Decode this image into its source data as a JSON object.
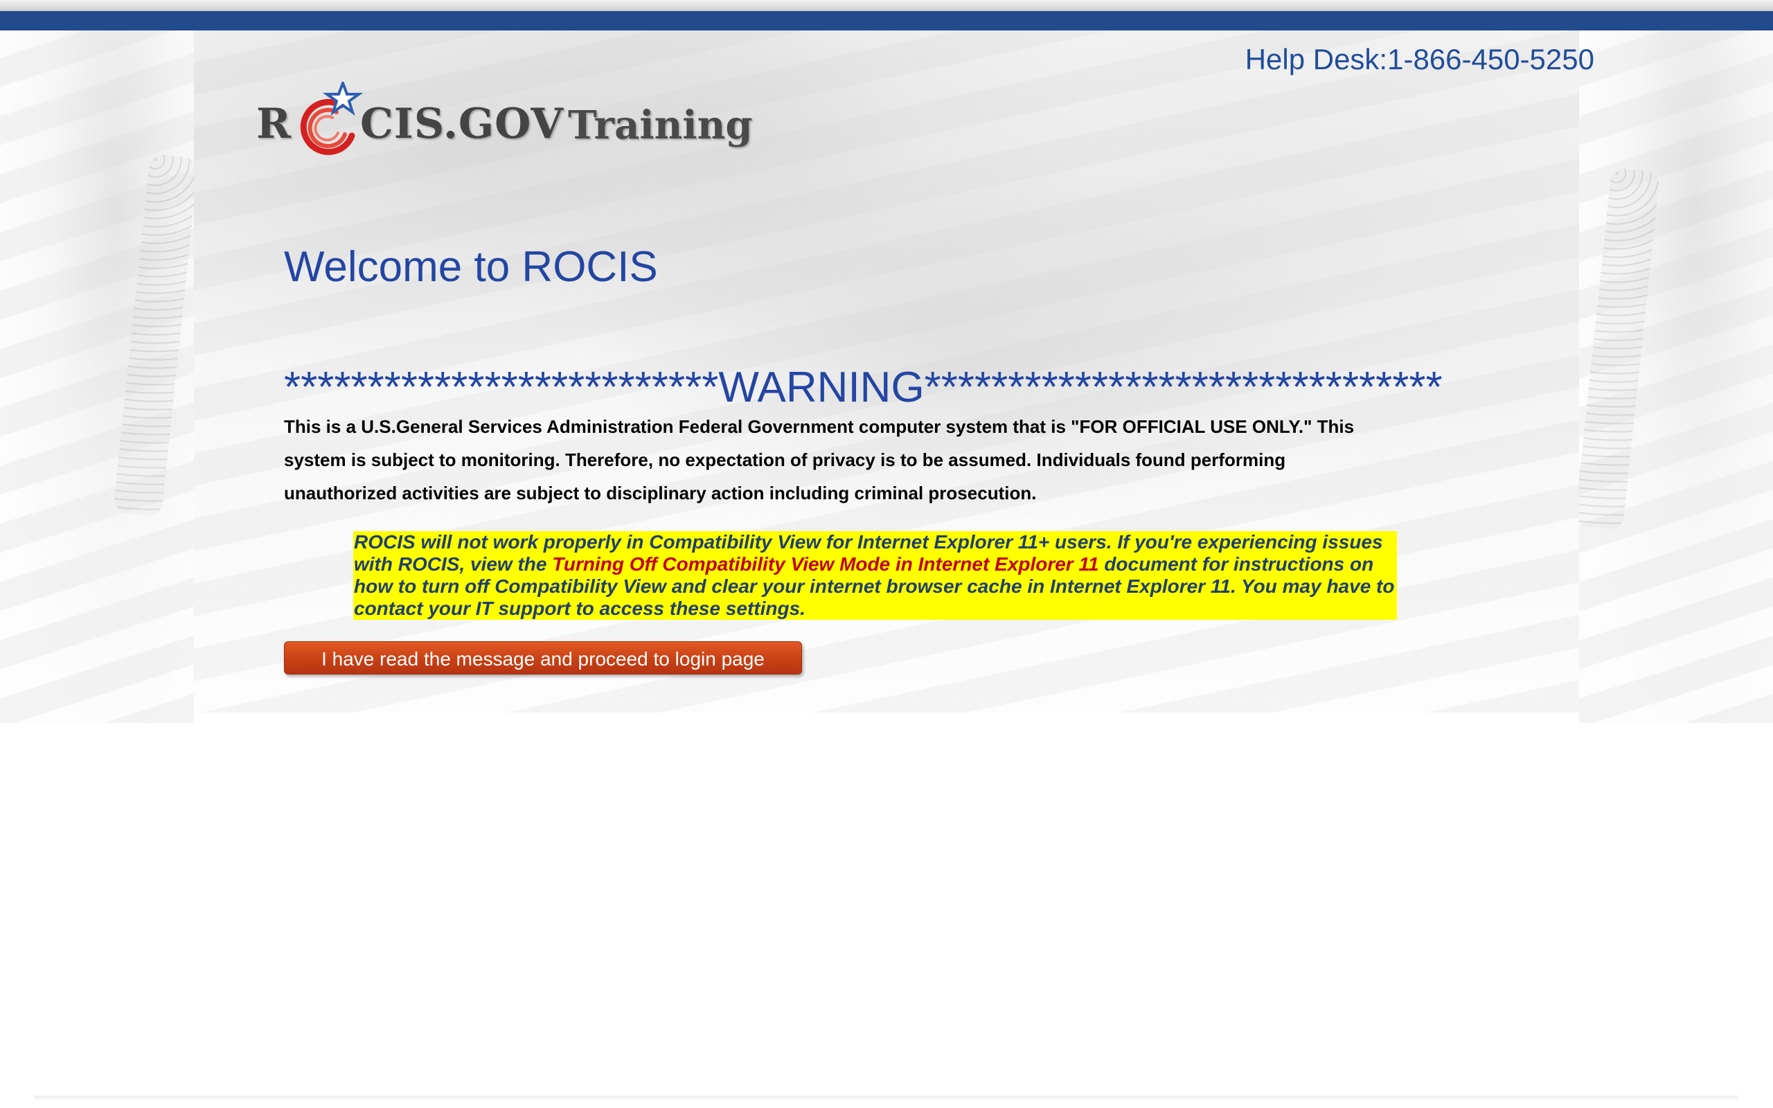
{
  "header": {
    "help_desk": "Help Desk:1-866-450-5250"
  },
  "logo": {
    "r_letter": "R",
    "rest": "CIS.GOV",
    "training": "Training"
  },
  "main": {
    "welcome": "Welcome to ROCIS",
    "warning_heading": "**************************WARNING*******************************",
    "notice_text": "This is a U.S.General Services Administration Federal Government computer system that is \"FOR OFFICIAL USE ONLY.\" This system is subject to monitoring. Therefore, no expectation of privacy is to be assumed. Individuals found performing unauthorized activities are subject to disciplinary action including criminal prosecution.",
    "ie_note_before": "ROCIS will not work properly in Compatibility View for Internet Explorer 11+ users. If you're experiencing issues with ROCIS, view the ",
    "ie_note_link": "Turning Off Compatibility View Mode in Internet Explorer 11",
    "ie_note_after": " document for instructions on how to turn off Compatibility View and clear your internet browser cache in Internet Explorer 11. You may have to contact your IT support to access these settings.",
    "proceed_button": "I have read the message and proceed to login page"
  },
  "colors": {
    "top_bar": "#234a8c",
    "heading_blue": "#2346a3",
    "highlight": "#ffff00",
    "link_red": "#c00000",
    "button": "#c84014"
  }
}
